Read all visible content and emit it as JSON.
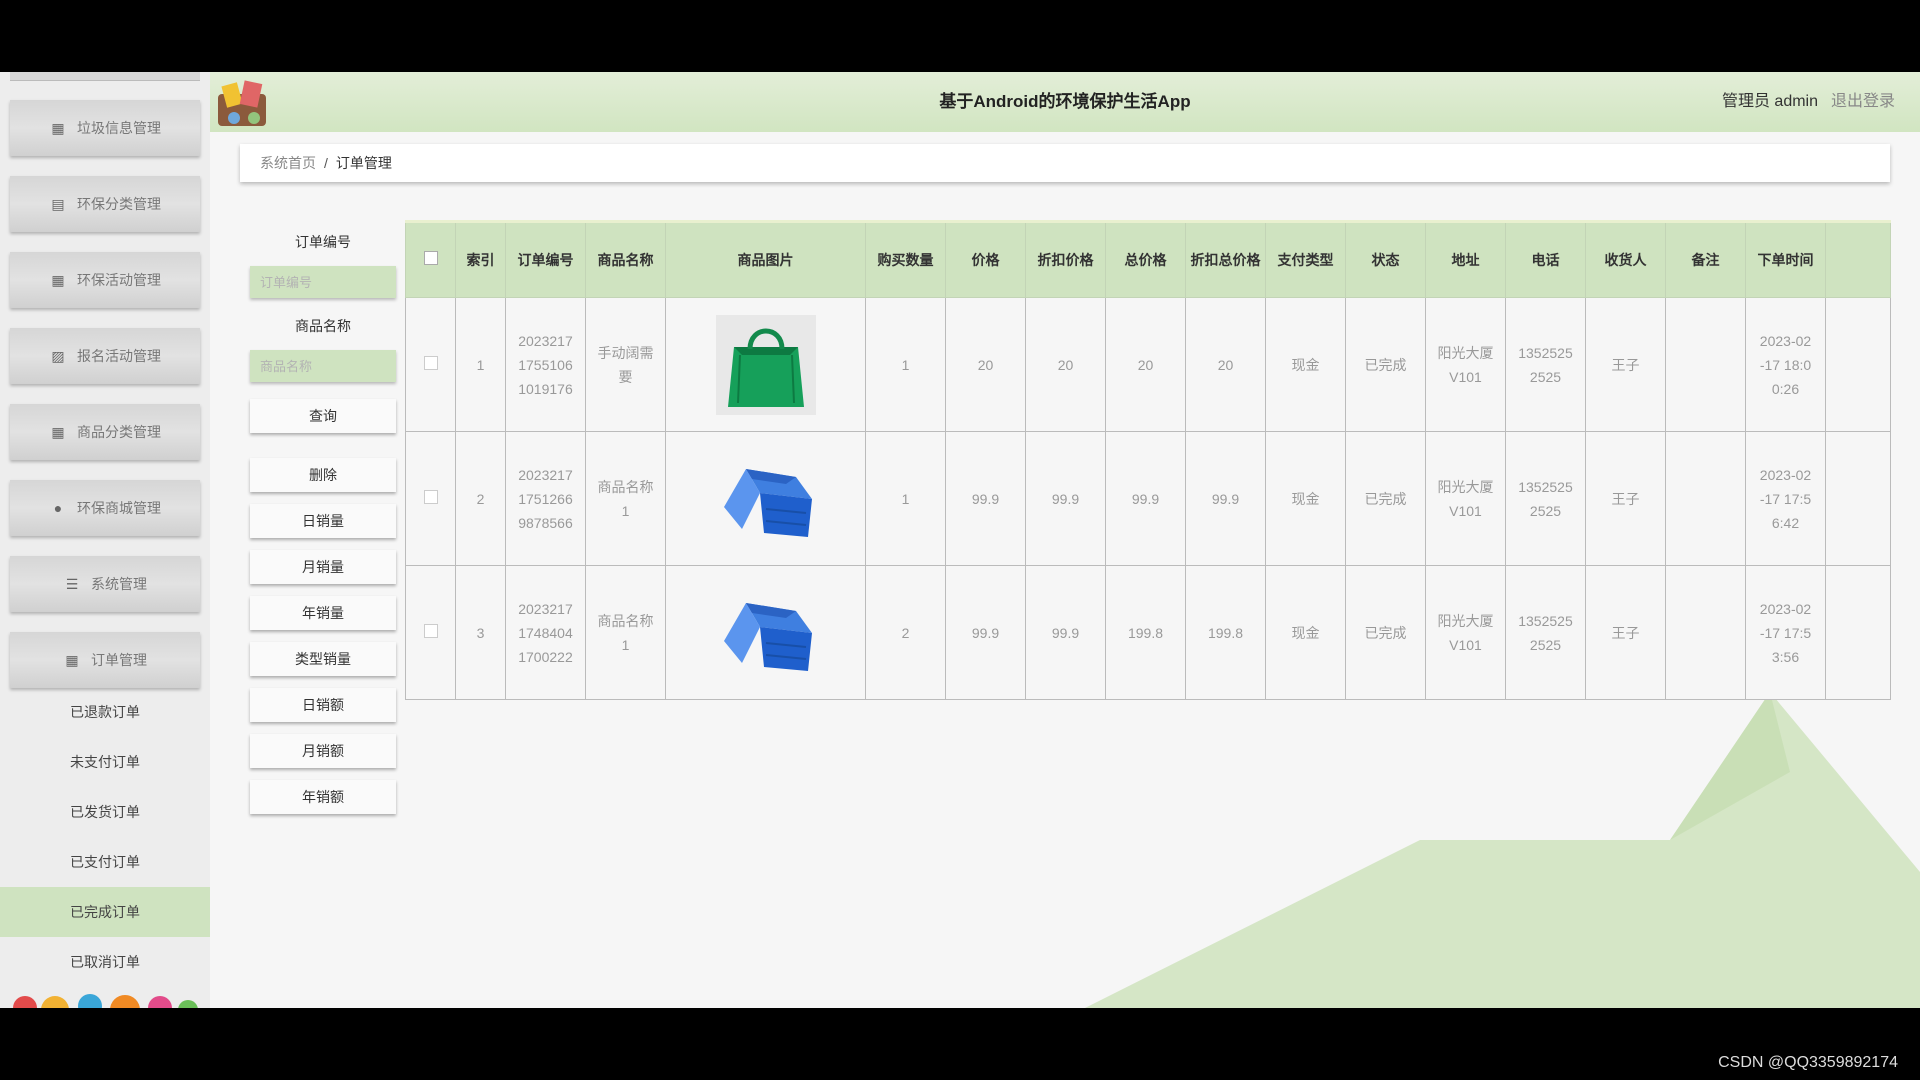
{
  "header": {
    "title": "基于Android的环境保护生活App",
    "admin_label": "管理员 admin",
    "logout_label": "退出登录"
  },
  "breadcrumb": {
    "home": "系统首页",
    "separator": "/",
    "current": "订单管理"
  },
  "sidebar": {
    "items": [
      {
        "label": "垃圾信息管理",
        "icon": "grid-icon"
      },
      {
        "label": "环保分类管理",
        "icon": "clipboard-icon"
      },
      {
        "label": "环保活动管理",
        "icon": "grid-icon"
      },
      {
        "label": "报名活动管理",
        "icon": "chart-icon"
      },
      {
        "label": "商品分类管理",
        "icon": "grid-icon"
      },
      {
        "label": "环保商城管理",
        "icon": "user-icon"
      },
      {
        "label": "系统管理",
        "icon": "menu-icon"
      },
      {
        "label": "订单管理",
        "icon": "grid-icon"
      }
    ],
    "sub_items": [
      {
        "label": "已退款订单"
      },
      {
        "label": "未支付订单"
      },
      {
        "label": "已发货订单"
      },
      {
        "label": "已支付订单"
      },
      {
        "label": "已完成订单",
        "active": true
      },
      {
        "label": "已取消订单"
      }
    ]
  },
  "filters": {
    "order_no_label": "订单编号",
    "order_no_placeholder": "订单编号",
    "product_name_label": "商品名称",
    "product_name_placeholder": "商品名称",
    "buttons": {
      "query": "查询",
      "delete": "删除",
      "daily_sales_qty": "日销量",
      "monthly_sales_qty": "月销量",
      "yearly_sales_qty": "年销量",
      "type_sales_qty": "类型销量",
      "daily_sales_amt": "日销额",
      "monthly_sales_amt": "月销额",
      "yearly_sales_amt": "年销额"
    }
  },
  "table": {
    "columns": [
      "索引",
      "订单编号",
      "商品名称",
      "商品图片",
      "购买数量",
      "价格",
      "折扣价格",
      "总价格",
      "折扣总价格",
      "支付类型",
      "状态",
      "地址",
      "电话",
      "收货人",
      "备注",
      "下单时间"
    ],
    "rows": [
      {
        "index": "1",
        "order_no": "20232171755106101917 6",
        "product": "手动阔需要",
        "image": "green-bag",
        "qty": "1",
        "price": "20",
        "discount_price": "20",
        "total": "20",
        "discount_total": "20",
        "pay_type": "现金",
        "status": "已完成",
        "address": "阳光大厦V101",
        "phone": "13525252525",
        "receiver": "王子",
        "note": "",
        "time": "2023-02-17 18:00:26"
      },
      {
        "index": "2",
        "order_no": "20232171751266987856 6",
        "product": "商品名称1",
        "image": "blue-crate",
        "qty": "1",
        "price": "99.9",
        "discount_price": "99.9",
        "total": "99.9",
        "discount_total": "99.9",
        "pay_type": "现金",
        "status": "已完成",
        "address": "阳光大厦V101",
        "phone": "13525252525",
        "receiver": "王子",
        "note": "",
        "time": "2023-02-17 17:56:42"
      },
      {
        "index": "3",
        "order_no": "20232171748404170022 2",
        "product": "商品名称1",
        "image": "blue-crate",
        "qty": "2",
        "price": "99.9",
        "discount_price": "99.9",
        "total": "199.8",
        "discount_total": "199.8",
        "pay_type": "现金",
        "status": "已完成",
        "address": "阳光大厦V101",
        "phone": "13525252525",
        "receiver": "王子",
        "note": "",
        "time": "2023-02-17 17:53:56"
      }
    ],
    "display": {
      "order_no": [
        [
          "2023217",
          "1755106",
          "1019176"
        ],
        [
          "2023217",
          "1751266",
          "9878566"
        ],
        [
          "2023217",
          "1748404",
          "1700222"
        ]
      ],
      "product": [
        [
          "手动阔需",
          "要"
        ],
        [
          "商品名称",
          "1"
        ],
        [
          "商品名称",
          "1"
        ]
      ],
      "address": [
        [
          "阳光大厦",
          "V101"
        ],
        [
          "阳光大厦",
          "V101"
        ],
        [
          "阳光大厦",
          "V101"
        ]
      ],
      "phone": [
        [
          "1352525",
          "2525"
        ],
        [
          "1352525",
          "2525"
        ],
        [
          "1352525",
          "2525"
        ]
      ],
      "time": [
        [
          "2023-02",
          "-17 18:0",
          "0:26"
        ],
        [
          "2023-02",
          "-17 17:5",
          "6:42"
        ],
        [
          "2023-02",
          "-17 17:5",
          "3:56"
        ]
      ]
    }
  },
  "watermark": "CSDN @QQ3359892174",
  "colors": {
    "accent_green": "#cfe3c0",
    "header_green": "#d1e5c1",
    "sidebar_bg": "#ededed"
  }
}
